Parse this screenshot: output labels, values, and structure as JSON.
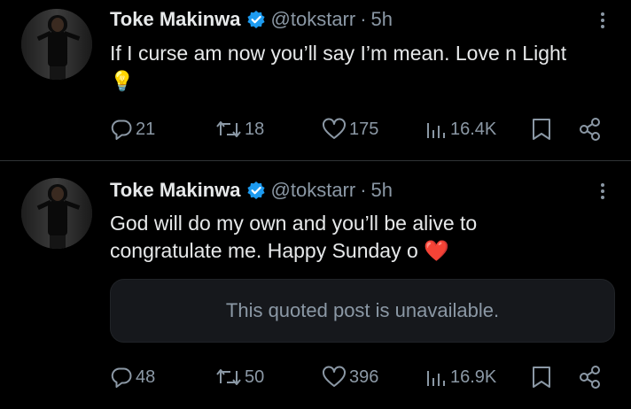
{
  "colors": {
    "background": "#000000",
    "text_primary": "#e7e9ea",
    "text_secondary": "#8b98a5",
    "verified_blue": "#1d9bf0",
    "divider": "#2f3336",
    "quote_bg": "#16181c",
    "heart_red": "#e0202e"
  },
  "posts": [
    {
      "author_name": "Toke Makinwa",
      "handle": "@tokstarr",
      "separator": "·",
      "time": "5h",
      "text_line1": "If I curse am now you’ll say I’m mean. Love n Light",
      "emoji": "💡",
      "actions": {
        "replies": "21",
        "reposts": "18",
        "likes": "175",
        "views": "16.4K"
      }
    },
    {
      "author_name": "Toke Makinwa",
      "handle": "@tokstarr",
      "separator": "·",
      "time": "5h",
      "text_line1": "God will do my own and you’ll be alive to",
      "text_line2": "congratulate me. Happy Sunday o",
      "emoji": "❤️",
      "quote_text": "This quoted post is unavailable.",
      "actions": {
        "replies": "48",
        "reposts": "50",
        "likes": "396",
        "views": "16.9K"
      }
    }
  ],
  "icons": {
    "verified": "verified-badge-icon",
    "more": "more-options-icon",
    "reply": "reply-bubble-icon",
    "repost": "repost-arrows-icon",
    "like": "heart-icon",
    "views": "views-bar-chart-icon",
    "bookmark": "bookmark-icon",
    "share": "share-icon"
  }
}
